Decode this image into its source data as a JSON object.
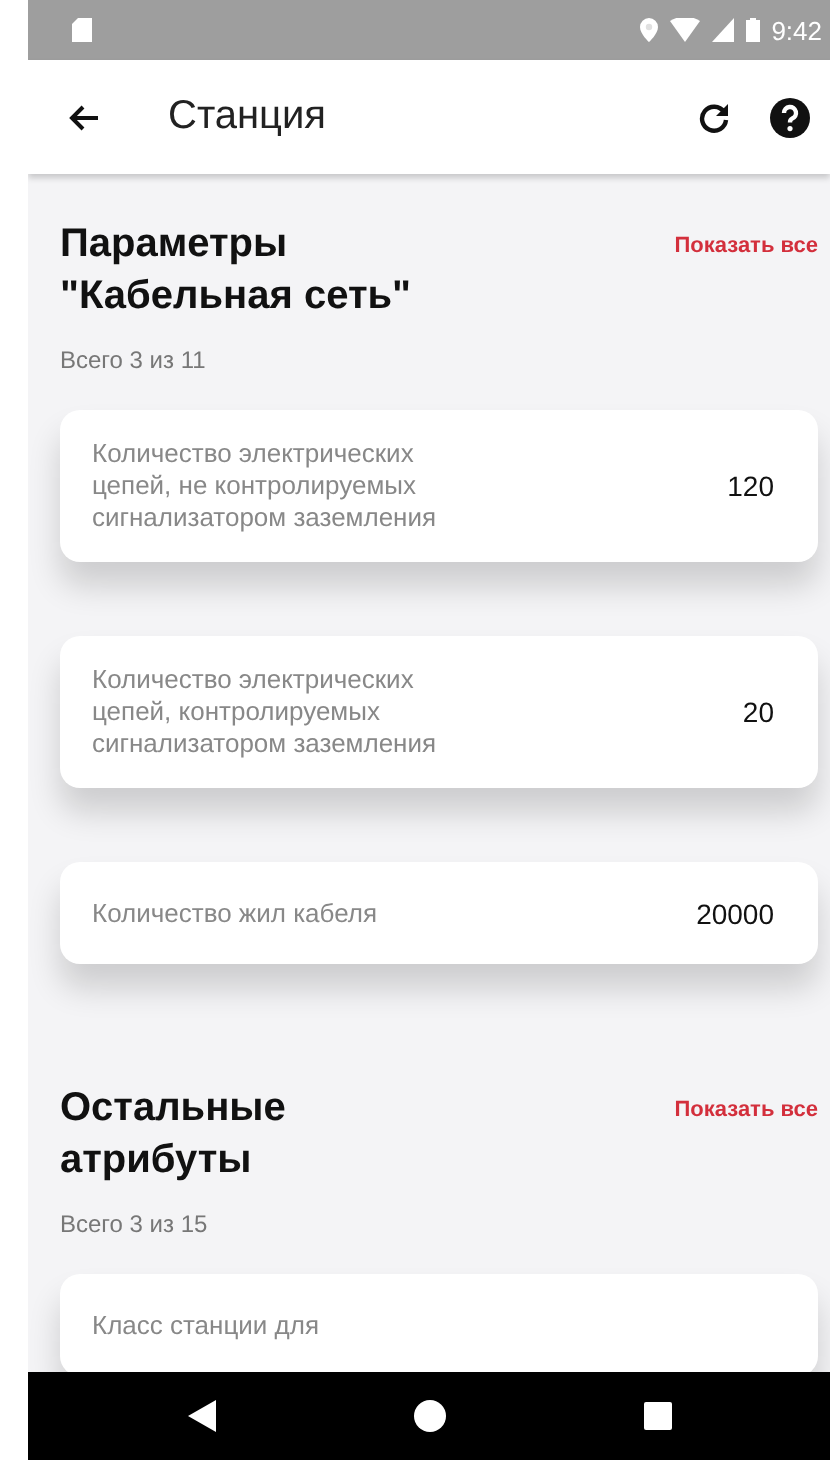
{
  "status_bar": {
    "time": "9:42"
  },
  "app_bar": {
    "title": "Станция"
  },
  "sections": [
    {
      "title": "Параметры \"Кабельная сеть\"",
      "action": "Показать все",
      "count": "Всего 3 из 11",
      "items": [
        {
          "label": "Количество электрических цепей, не контролируемых сигнализатором заземления",
          "value": "120"
        },
        {
          "label": "Количество электрических цепей, контролируемых сигнализатором заземления",
          "value": "20"
        },
        {
          "label": "Количество жил кабеля",
          "value": "20000"
        }
      ]
    },
    {
      "title": "Остальные атрибуты",
      "action": "Показать все",
      "count": "Всего 3 из 15",
      "items": [
        {
          "label": "Класс станции для"
        }
      ]
    }
  ]
}
